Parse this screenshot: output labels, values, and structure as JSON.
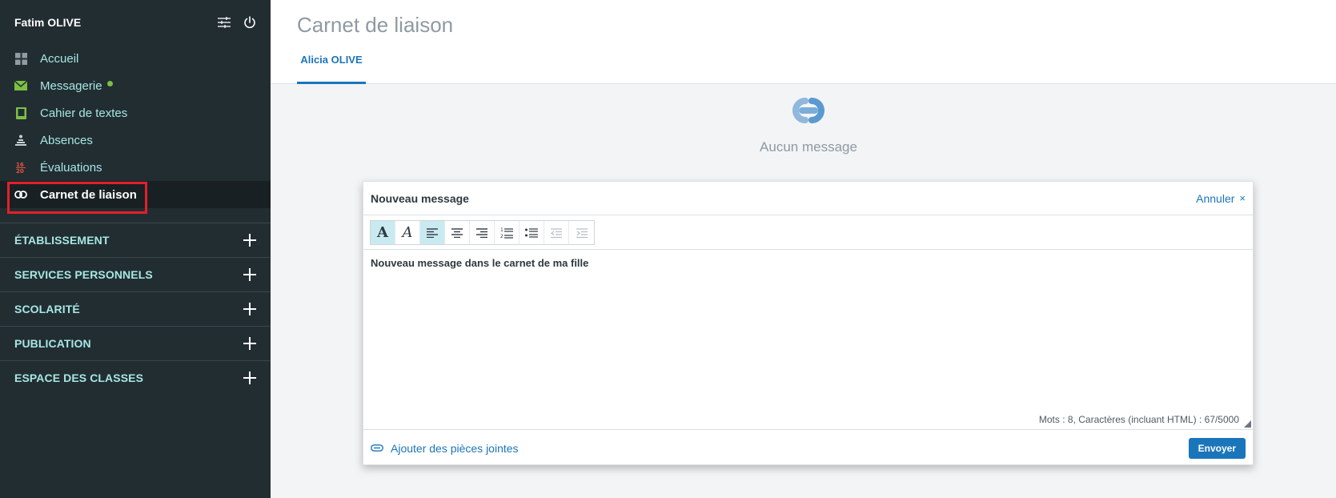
{
  "sidebar": {
    "user_name": "Fatim OLIVE",
    "nav": [
      {
        "label": "Accueil",
        "icon": "grid-icon"
      },
      {
        "label": "Messagerie",
        "icon": "envelope-icon",
        "has_dot": true
      },
      {
        "label": "Cahier de textes",
        "icon": "notebook-icon"
      },
      {
        "label": "Absences",
        "icon": "absences-icon"
      },
      {
        "label": "Évaluations",
        "icon": "grades-icon",
        "icon_text": "16\n20"
      },
      {
        "label": "Carnet de liaison",
        "icon": "link-icon",
        "active": true
      }
    ],
    "sections": [
      {
        "label": "ÉTABLISSEMENT"
      },
      {
        "label": "SERVICES PERSONNELS"
      },
      {
        "label": "SCOLARITÉ"
      },
      {
        "label": "PUBLICATION"
      },
      {
        "label": "ESPACE DES CLASSES"
      }
    ]
  },
  "main": {
    "title": "Carnet de liaison",
    "tabs": [
      {
        "label": "Alicia OLIVE",
        "active": true
      }
    ],
    "empty_text": "Aucun message"
  },
  "message": {
    "title": "Nouveau message",
    "cancel_label": "Annuler",
    "cancel_icon": "×",
    "body": "Nouveau message dans le carnet de ma fille",
    "counter": "Mots : 8, Caractères (incluant HTML) : 67/5000",
    "attach_label": "Ajouter des pièces jointes",
    "send_label": "Envoyer",
    "toolbar": [
      {
        "name": "bold",
        "glyph": "A"
      },
      {
        "name": "italic",
        "glyph": "A"
      },
      {
        "name": "align-left"
      },
      {
        "name": "align-center"
      },
      {
        "name": "align-right"
      },
      {
        "name": "ordered-list"
      },
      {
        "name": "bullet-list"
      },
      {
        "name": "outdent"
      },
      {
        "name": "indent"
      }
    ]
  },
  "colors": {
    "sidebar_bg": "#222d32",
    "nav_text": "#a6e7e2",
    "accent": "#1b75bb",
    "highlight": "#e3202a",
    "online_dot": "#7bc043"
  }
}
